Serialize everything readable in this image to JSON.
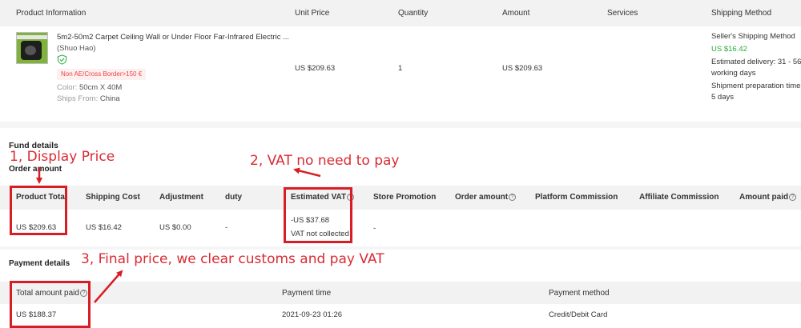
{
  "product_table": {
    "headers": [
      "Product Information",
      "Unit Price",
      "Quantity",
      "Amount",
      "Services",
      "Shipping Method"
    ],
    "item": {
      "title": "5m2-50m2 Carpet Ceiling Wall or Under Floor Far-Infrared Electric ...",
      "store": "(Shuo Hao)",
      "tag": "Non AE/Cross Border>150 €",
      "color_label": "Color:",
      "color_value": "50cm X 40M",
      "ships_label": "Ships From:",
      "ships_value": "China",
      "unit_price": "US $209.63",
      "quantity": "1",
      "amount": "US $209.63",
      "shipping_method": "Seller's Shipping Method",
      "shipping_cost": "US $16.42",
      "delivery_line1": "Estimated delivery: 31 - 56",
      "delivery_line2": "working days",
      "prep_line1": "Shipment preparation time:",
      "prep_line2": "5 days"
    }
  },
  "fund_details": {
    "title": "Fund details",
    "subtitle": "Order amount",
    "headers": [
      "Product Total",
      "Shipping Cost",
      "Adjustment",
      "duty",
      "Estimated VAT",
      "Store Promotion",
      "Order amount",
      "Platform Commission",
      "Affiliate Commission",
      "Amount paid"
    ],
    "values": {
      "product_total": "US $209.63",
      "shipping_cost": "US $16.42",
      "adjustment": "US $0.00",
      "duty": "-",
      "vat": "-US $37.68",
      "vat_note": "VAT not collected",
      "store_promotion": "-"
    }
  },
  "payment_details": {
    "title": "Payment details",
    "headers": [
      "Total amount paid",
      "Payment time",
      "Payment method"
    ],
    "values": {
      "total": "US $188.37",
      "time": "2021-09-23 01:26",
      "method": "Credit/Debit Card"
    }
  },
  "annotations": {
    "note1": "1, Display Price",
    "note2": "2, VAT no need to pay",
    "note3": "3, Final price, we clear customs and pay VAT"
  },
  "icons": {
    "verified": "shield-check-icon",
    "help": "question-circle-icon"
  },
  "colors": {
    "accent_green": "#2bab3a",
    "tag_red": "#e6464b",
    "annotation_red": "#d91d25"
  }
}
